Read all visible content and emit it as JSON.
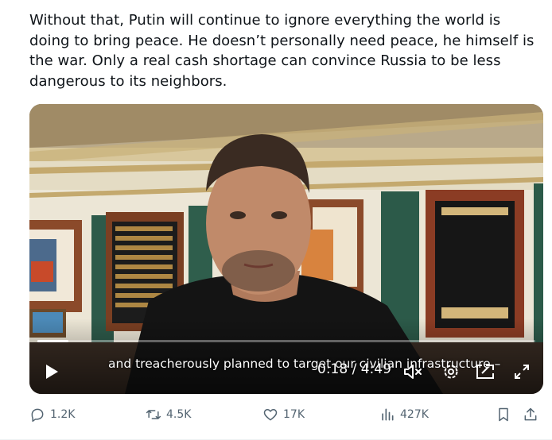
{
  "post": {
    "text": "Without that, Putin will continue to ignore everything the world is doing to bring peace. He doesn’t personally need peace, he himself is the war. Only a real cash shortage can convince Russia to be less dangerous to its neighbors."
  },
  "video": {
    "caption": "and treacherously planned to target our civilian infrastructure –",
    "time": "0:18 / 4:49",
    "progress": 0.062,
    "icons": [
      "play-icon",
      "mute-icon",
      "settings-icon",
      "pip-icon",
      "fullscreen-icon"
    ]
  },
  "actions": {
    "replies": "1.2K",
    "reposts": "4.5K",
    "likes": "17K",
    "views": "427K"
  },
  "colors": {
    "text": "#0f1419",
    "muted": "#536471",
    "divider": "#eff3f4"
  }
}
